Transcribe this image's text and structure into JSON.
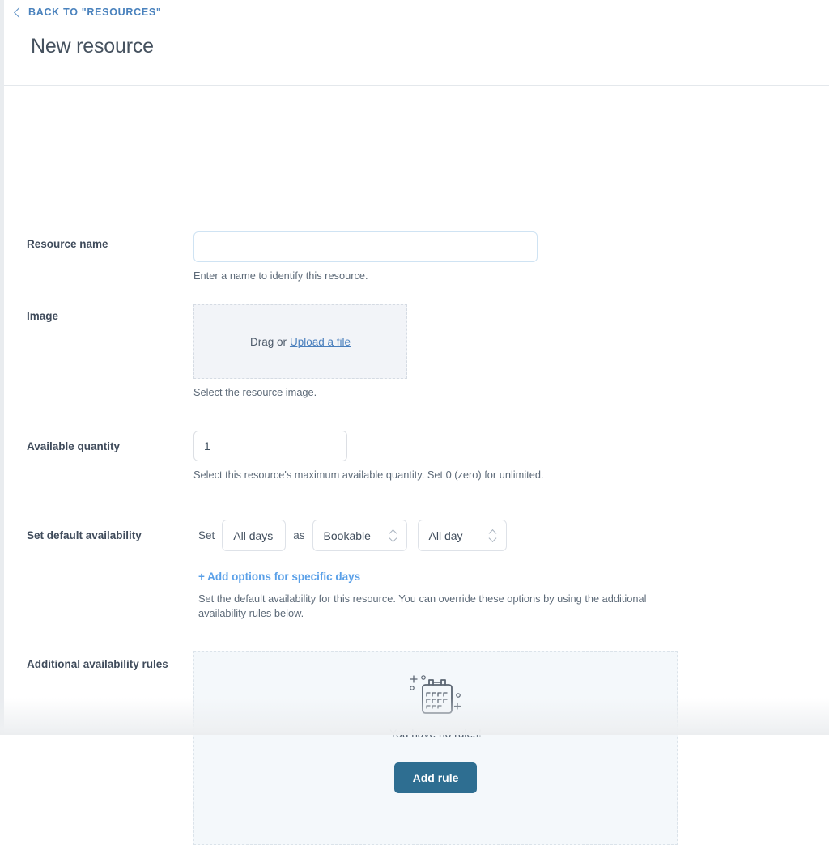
{
  "header": {
    "back_label": "BACK TO \"RESOURCES\"",
    "title": "New resource"
  },
  "form": {
    "resource_name": {
      "label": "Resource name",
      "value": "",
      "placeholder": "",
      "help": "Enter a name to identify this resource."
    },
    "image": {
      "label": "Image",
      "drag_text": "Drag or",
      "upload_link": "Upload a file",
      "help": "Select the resource image."
    },
    "quantity": {
      "label": "Available quantity",
      "value": "1",
      "help": "Select this resource's maximum available quantity. Set 0 (zero) for unlimited."
    },
    "default_availability": {
      "label": "Set default availability",
      "word_set": "Set",
      "days_value": "All days",
      "word_as": "as",
      "status_value": "Bookable",
      "time_value": "All day",
      "add_options_link": "+ Add options for specific days",
      "help": "Set the default availability for this resource. You can override these options by using the additional availability rules below."
    },
    "additional_rules": {
      "label": "Additional availability rules",
      "empty_text": "You have no rules!",
      "add_button": "Add rule"
    }
  },
  "colors": {
    "link_blue": "#4a82bd",
    "accent_blue": "#5aa0e8",
    "button_teal": "#2e6e91",
    "label_slate": "#3f4b5b",
    "panel_bg": "#f4f8fb"
  }
}
